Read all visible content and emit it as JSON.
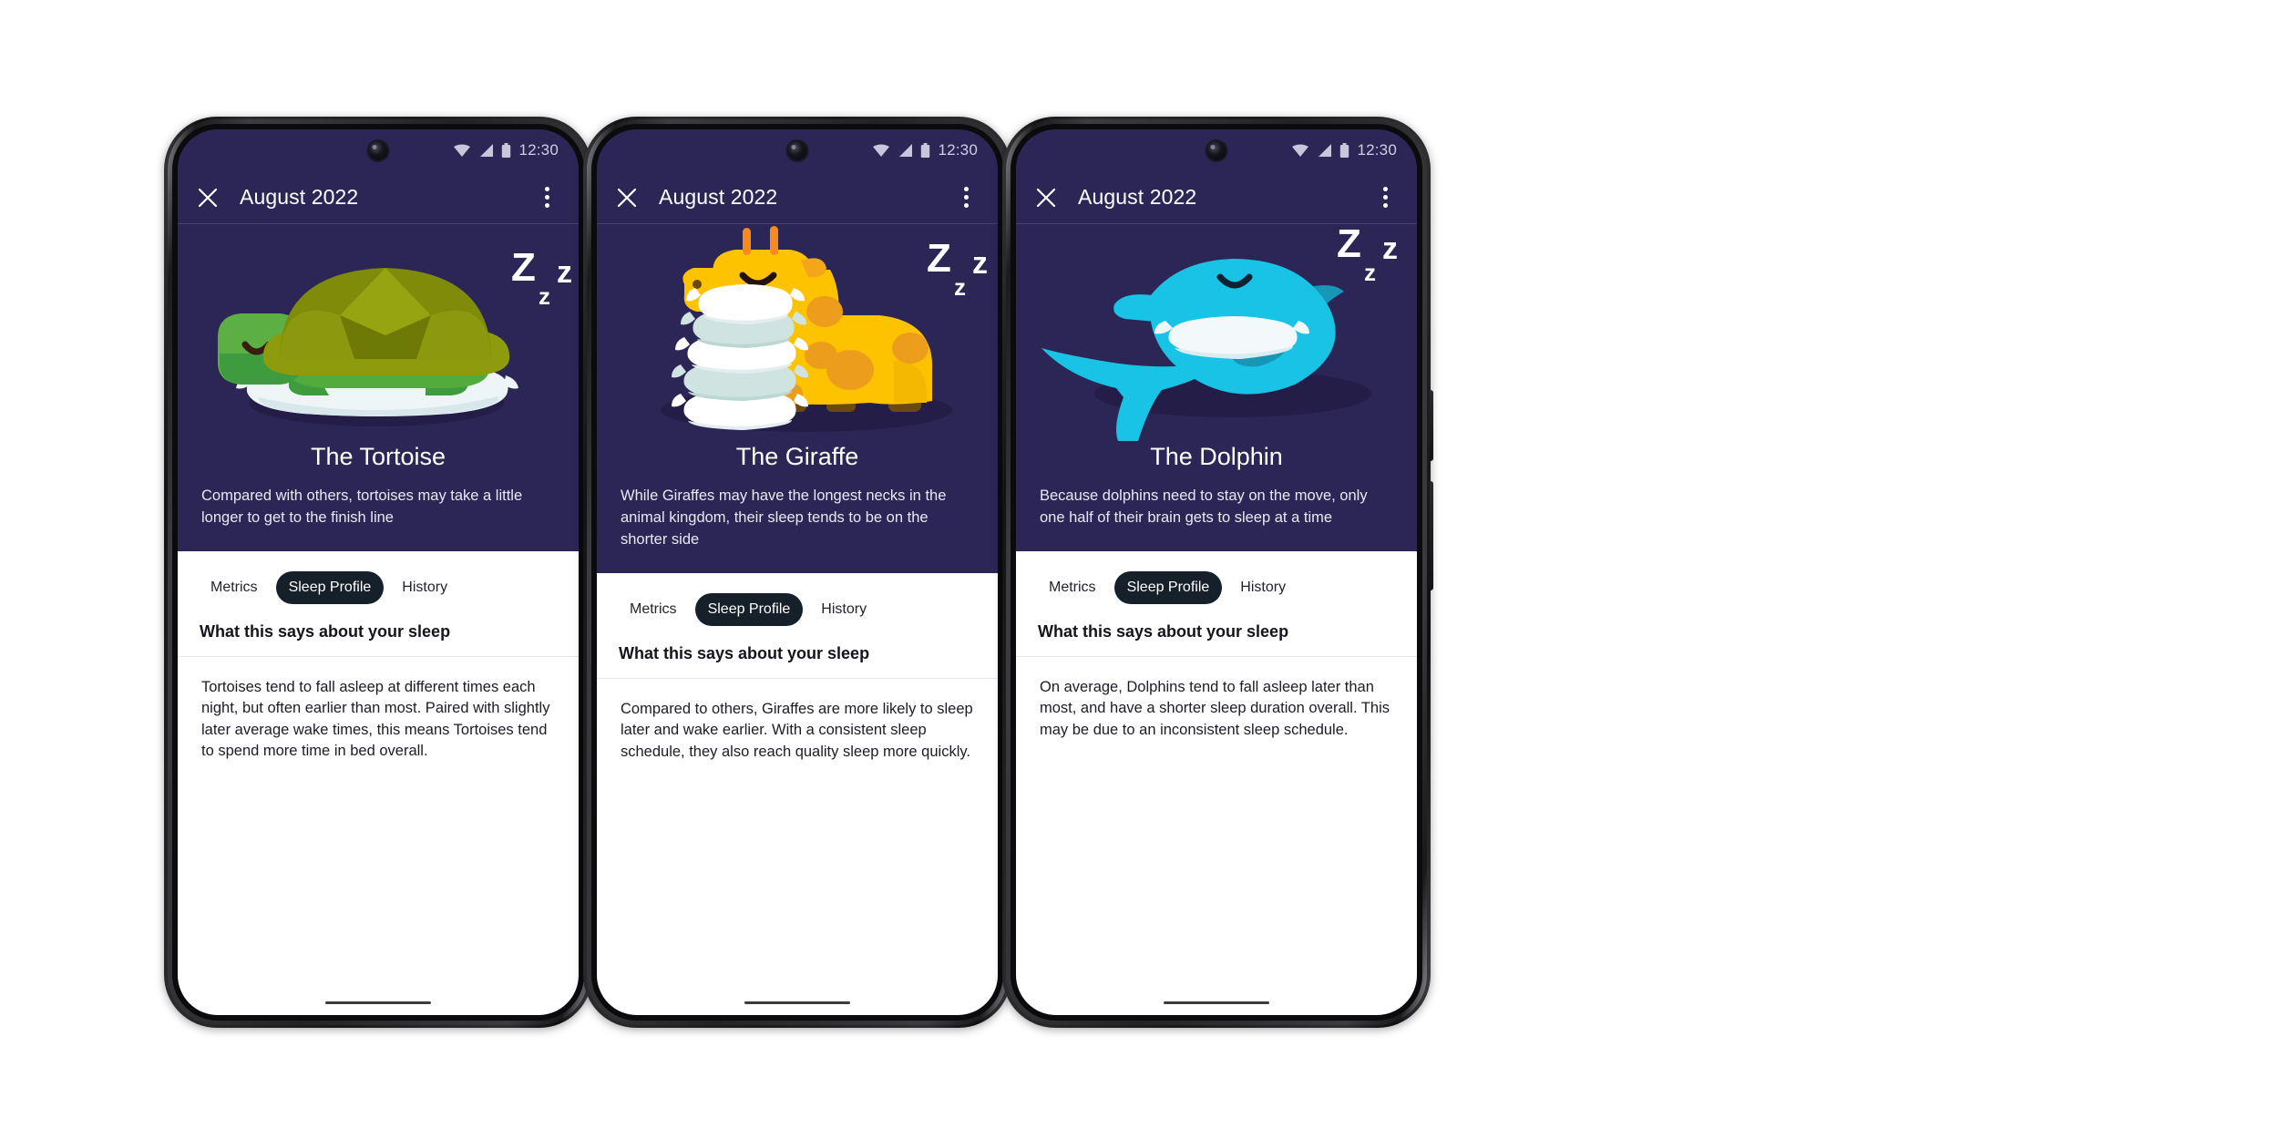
{
  "meta": {
    "colors": {
      "hero_bg": "#2c2657",
      "sheet_bg": "#ffffff",
      "tab_active_bg": "#15202b",
      "tortoise_shell": "#7d8c0a",
      "tortoise_body": "#3e9c3e",
      "giraffe_body": "#fdc300",
      "dolphin_body": "#19c3e6"
    }
  },
  "statusbar": {
    "time": "12:30",
    "icons": [
      "wifi-icon",
      "signal-icon",
      "battery-icon"
    ]
  },
  "appbar": {
    "close_icon": "close-icon",
    "title": "August 2022",
    "overflow_icon": "more-vertical-icon"
  },
  "tabs": [
    {
      "label": "Metrics",
      "active": false
    },
    {
      "label": "Sleep Profile",
      "active": true
    },
    {
      "label": "History",
      "active": false
    }
  ],
  "section": {
    "heading": "What this says about your sleep"
  },
  "phones": [
    {
      "id": "tortoise",
      "artwork": "tortoise-sleeping-illustration",
      "zzz": [
        "Z",
        "z",
        "z"
      ],
      "title": "The Tortoise",
      "description": "Compared with others, tortoises may take a little longer to get to the finish line",
      "body": "Tortoises tend to fall asleep at different times each night, but often earlier than most. Paired with slightly later average wake times, this means Tortoises tend to spend more time in bed overall."
    },
    {
      "id": "giraffe",
      "artwork": "giraffe-sleeping-illustration",
      "zzz": [
        "Z",
        "z",
        "z"
      ],
      "title": "The Giraffe",
      "description": "While Giraffes may have the longest necks in the animal kingdom, their sleep tends to be on the shorter side",
      "body": "Compared to others, Giraffes are more likely to sleep later and wake earlier. With a consistent sleep schedule, they also reach quality sleep more quickly."
    },
    {
      "id": "dolphin",
      "artwork": "dolphin-sleeping-illustration",
      "zzz": [
        "Z",
        "z",
        "z"
      ],
      "title": "The Dolphin",
      "description": "Because dolphins need to stay on the move, only one half of their brain gets to sleep at a time",
      "body": "On average, Dolphins tend to fall asleep later than most, and have a shorter sleep duration overall. This may be due to an inconsistent sleep schedule."
    }
  ]
}
